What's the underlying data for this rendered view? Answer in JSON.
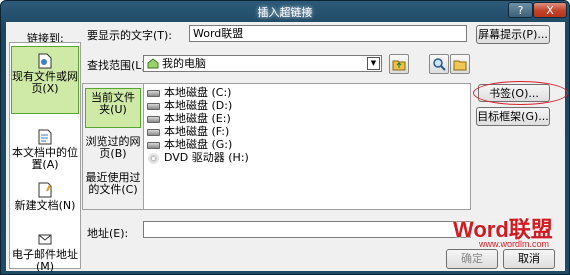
{
  "window": {
    "title": "插入超链接"
  },
  "titlebar": {
    "help_label": "?",
    "close_label": "X"
  },
  "sidebar": {
    "title": "链接到:",
    "items": [
      {
        "label": "现有文件或网页(X)",
        "selected": true
      },
      {
        "label": "本文档中的位置(A)",
        "selected": false
      },
      {
        "label": "新建文档(N)",
        "selected": false
      },
      {
        "label": "电子邮件地址(M)",
        "selected": false
      }
    ]
  },
  "display_text": {
    "label": "要显示的文字(T):",
    "value": "Word联盟"
  },
  "screen_tip_button": "屏幕提示(P)...",
  "look_in": {
    "label": "查找范围(L):",
    "value": "我的电脑"
  },
  "nav": {
    "items": [
      {
        "label": "当前文件夹(U)",
        "selected": true
      },
      {
        "label": "浏览过的网页(B)",
        "selected": false
      },
      {
        "label": "最近使用过的文件(C)",
        "selected": false
      }
    ]
  },
  "files": [
    {
      "icon": "drive-icon",
      "name": "本地磁盘 (C:)"
    },
    {
      "icon": "drive-icon",
      "name": "本地磁盘 (D:)"
    },
    {
      "icon": "drive-icon",
      "name": "本地磁盘 (E:)"
    },
    {
      "icon": "drive-icon",
      "name": "本地磁盘 (F:)"
    },
    {
      "icon": "drive-icon",
      "name": "本地磁盘 (G:)"
    },
    {
      "icon": "dvd-icon",
      "name": "DVD 驱动器 (H:)"
    }
  ],
  "bookmark_button": "书签(O)...",
  "target_frame_button": "目标框架(G)...",
  "address": {
    "label": "地址(E):",
    "value": ""
  },
  "bottom": {
    "ok_label": "确定",
    "cancel_label": "取消"
  },
  "watermark": {
    "brand": "Word联盟",
    "url": "www.wordlm.com"
  },
  "colors": {
    "selection": "#cfe9a6",
    "highlight_ring": "#d9202a",
    "title_bar": "#1c4661"
  }
}
